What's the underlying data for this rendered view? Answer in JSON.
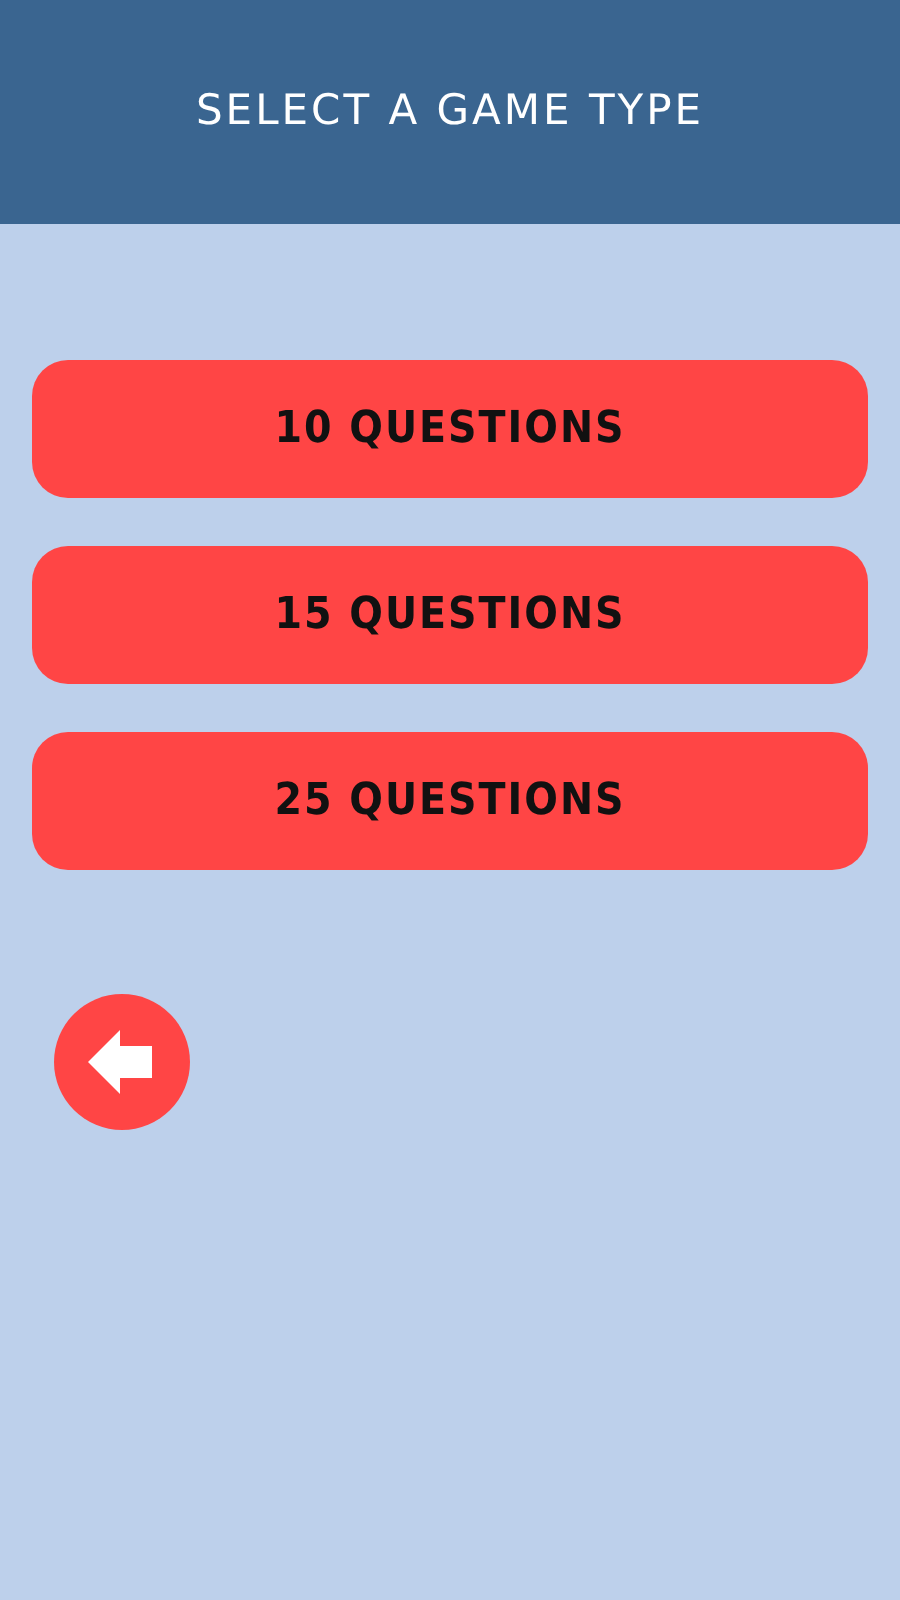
{
  "header": {
    "title": "SELECT A GAME TYPE"
  },
  "game_types": [
    {
      "label": "10 QUESTIONS"
    },
    {
      "label": "15 QUESTIONS"
    },
    {
      "label": "25 QUESTIONS"
    }
  ]
}
